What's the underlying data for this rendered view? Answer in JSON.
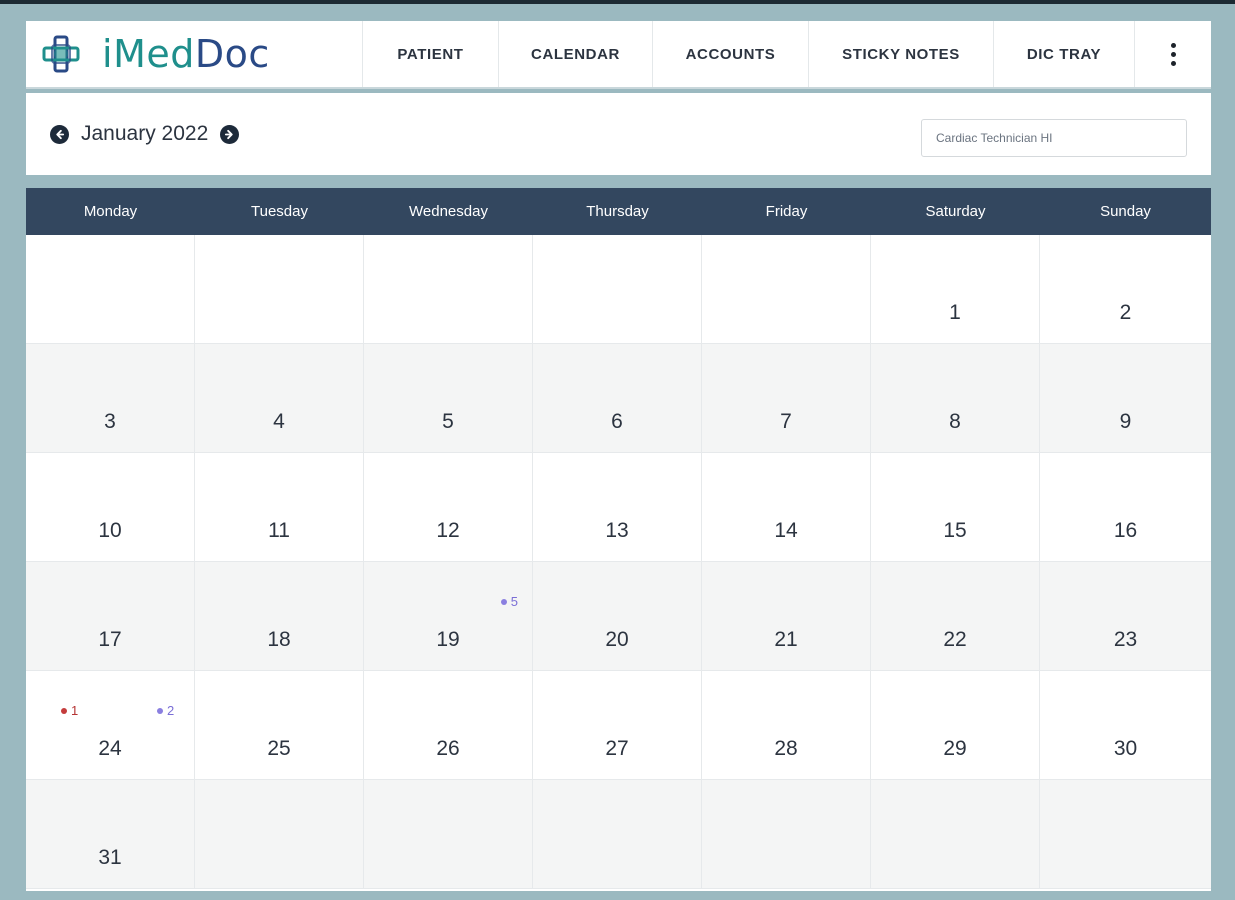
{
  "brand": {
    "name_i": "i",
    "name_med": "Med",
    "name_doc": "Doc"
  },
  "nav": {
    "items": [
      "PATIENT",
      "CALENDAR",
      "ACCOUNTS",
      "STICKY NOTES",
      "DIC TRAY"
    ]
  },
  "toolbar": {
    "month_label": "January 2022",
    "role_select_value": "Cardiac Technician HI"
  },
  "calendar": {
    "weekdays": [
      "Monday",
      "Tuesday",
      "Wednesday",
      "Thursday",
      "Friday",
      "Saturday",
      "Sunday"
    ],
    "weeks": [
      [
        "",
        "",
        "",
        "",
        "",
        "1",
        "2"
      ],
      [
        "3",
        "4",
        "5",
        "6",
        "7",
        "8",
        "9"
      ],
      [
        "10",
        "11",
        "12",
        "13",
        "14",
        "15",
        "16"
      ],
      [
        "17",
        "18",
        "19",
        "20",
        "21",
        "22",
        "23"
      ],
      [
        "24",
        "25",
        "26",
        "27",
        "28",
        "29",
        "30"
      ],
      [
        "31",
        "",
        "",
        "",
        "",
        "",
        ""
      ]
    ],
    "events": {
      "19": [
        {
          "count": "5",
          "color": "purple"
        }
      ],
      "24": [
        {
          "count": "1",
          "color": "red"
        },
        {
          "count": "2",
          "color": "purple"
        }
      ]
    }
  },
  "colors": {
    "brand_teal": "#1f8f8c",
    "brand_navy": "#2a4a86",
    "weekday_bar": "#33475f",
    "event_red": "#c43c3c",
    "event_purple": "#8a7fe0"
  }
}
